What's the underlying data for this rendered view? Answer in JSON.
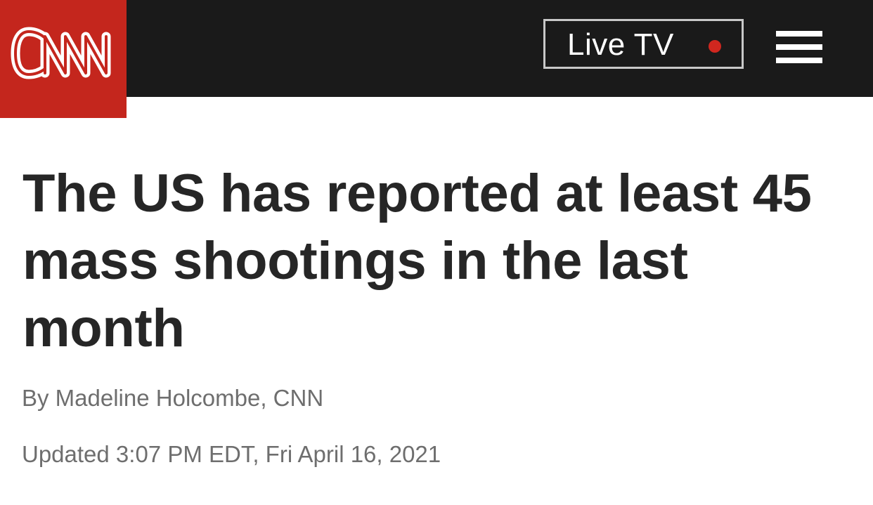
{
  "header": {
    "logo": {
      "text": "CNN",
      "icon": "cnn-logo",
      "background_color": "#c4261d"
    },
    "live_tv": {
      "label": "Live TV",
      "indicator_color": "#d0271f"
    },
    "menu": {
      "icon": "hamburger-menu-icon"
    }
  },
  "article": {
    "headline": "The US has reported at least 45 mass shootings in the last month",
    "byline": "By Madeline Holcombe, CNN",
    "updated": "Updated 3:07 PM EDT, Fri April 16, 2021"
  }
}
